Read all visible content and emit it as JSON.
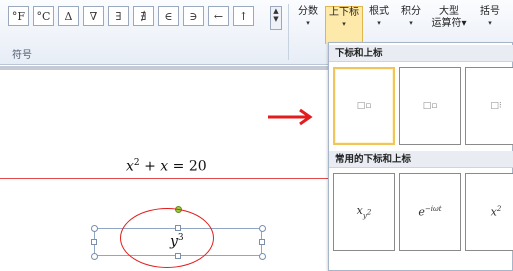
{
  "ribbon": {
    "symbols": [
      "°F",
      "°C",
      "Δ",
      "∇",
      "∃",
      "∄",
      "∈",
      "∋",
      "←",
      "↑"
    ],
    "scroll_glyph_up": "▲",
    "scroll_glyph_down": "▼",
    "group_label": "符号",
    "buttons": {
      "fraction": "分数",
      "subsup": "上下标",
      "radical": "根式",
      "integral": "积分",
      "large_operator_line1": "大型",
      "large_operator_line2": "运算符",
      "bracket": "括号"
    },
    "dropdown_arrow": "▾"
  },
  "document": {
    "equation": {
      "x": "x",
      "exp": "2",
      "plus": " + ",
      "x2": "x",
      "eq": " = ",
      "rhs": "20"
    },
    "selected": {
      "base": "y",
      "exp": "3"
    }
  },
  "panel": {
    "section1_title": "下标和上标",
    "section2_title": "常用的下标和上标",
    "templates": [
      {
        "name": "superscript",
        "glyph": "□▫"
      },
      {
        "name": "subscript",
        "glyph": "□▫"
      },
      {
        "name": "sub-superscript",
        "glyph": "□⁝"
      }
    ],
    "common": [
      {
        "base": "x",
        "sub": "y",
        "subsup": "2"
      },
      {
        "base": "e",
        "sup": "−iωt"
      },
      {
        "base": "x",
        "sup": "2"
      }
    ]
  },
  "colors": {
    "accent_red": "#e11d1d",
    "selected_tile_border": "#f2c55c"
  }
}
